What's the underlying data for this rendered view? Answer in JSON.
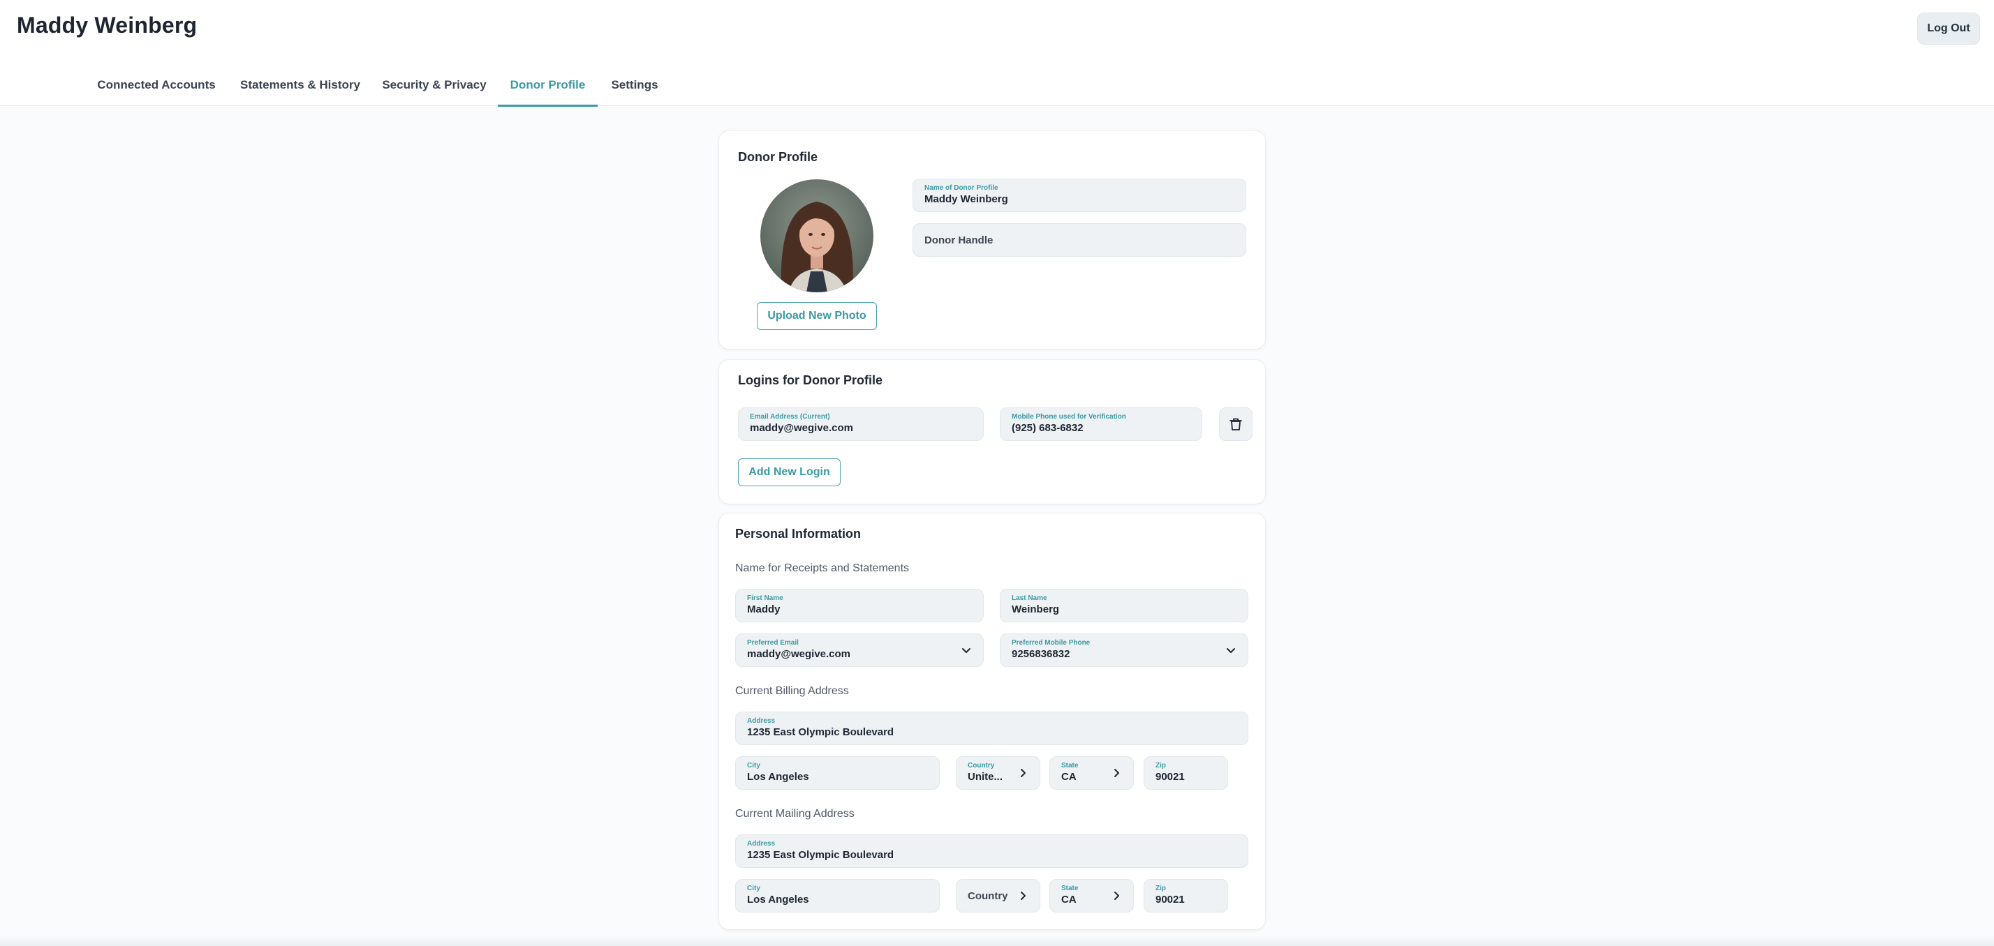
{
  "header": {
    "user_name": "Maddy Weinberg",
    "logout_label": "Log Out"
  },
  "tabs": [
    {
      "label": "Connected Accounts",
      "active": false
    },
    {
      "label": "Statements & History",
      "active": false
    },
    {
      "label": "Security & Privacy",
      "active": false
    },
    {
      "label": "Donor Profile",
      "active": true
    },
    {
      "label": "Settings",
      "active": false
    }
  ],
  "donor_profile": {
    "title": "Donor Profile",
    "name_label": "Name of Donor Profile",
    "name_value": "Maddy Weinberg",
    "handle_placeholder": "Donor Handle",
    "upload_label": "Upload New Photo"
  },
  "logins": {
    "title": "Logins for Donor Profile",
    "email_label": "Email Address (Current)",
    "email_value": "maddy@wegive.com",
    "phone_label": "Mobile Phone used for Verification",
    "phone_value": "(925) 683-6832",
    "add_label": "Add New Login"
  },
  "personal": {
    "title": "Personal Information",
    "name_section": "Name for Receipts and Statements",
    "first_name_label": "First Name",
    "first_name_value": "Maddy",
    "last_name_label": "Last Name",
    "last_name_value": "Weinberg",
    "pref_email_label": "Preferred Email",
    "pref_email_value": "maddy@wegive.com",
    "pref_phone_label": "Preferred Mobile Phone",
    "pref_phone_value": "9256836832",
    "billing": {
      "section": "Current Billing Address",
      "address_label": "Address",
      "address_value": "1235 East Olympic Boulevard",
      "city_label": "City",
      "city_value": "Los Angeles",
      "country_label": "Country",
      "country_value": "Unite...",
      "state_label": "State",
      "state_value": "CA",
      "zip_label": "Zip",
      "zip_value": "90021"
    },
    "mailing": {
      "section": "Current Mailing Address",
      "address_label": "Address",
      "address_value": "1235 East Olympic Boulevard",
      "city_label": "City",
      "city_value": "Los Angeles",
      "country_placeholder": "Country",
      "state_label": "State",
      "state_value": "CA",
      "zip_label": "Zip",
      "zip_value": "90021"
    }
  },
  "colors": {
    "accent": "#3b9aa3",
    "field_bg": "#eef2f4",
    "text": "#1f2733"
  }
}
